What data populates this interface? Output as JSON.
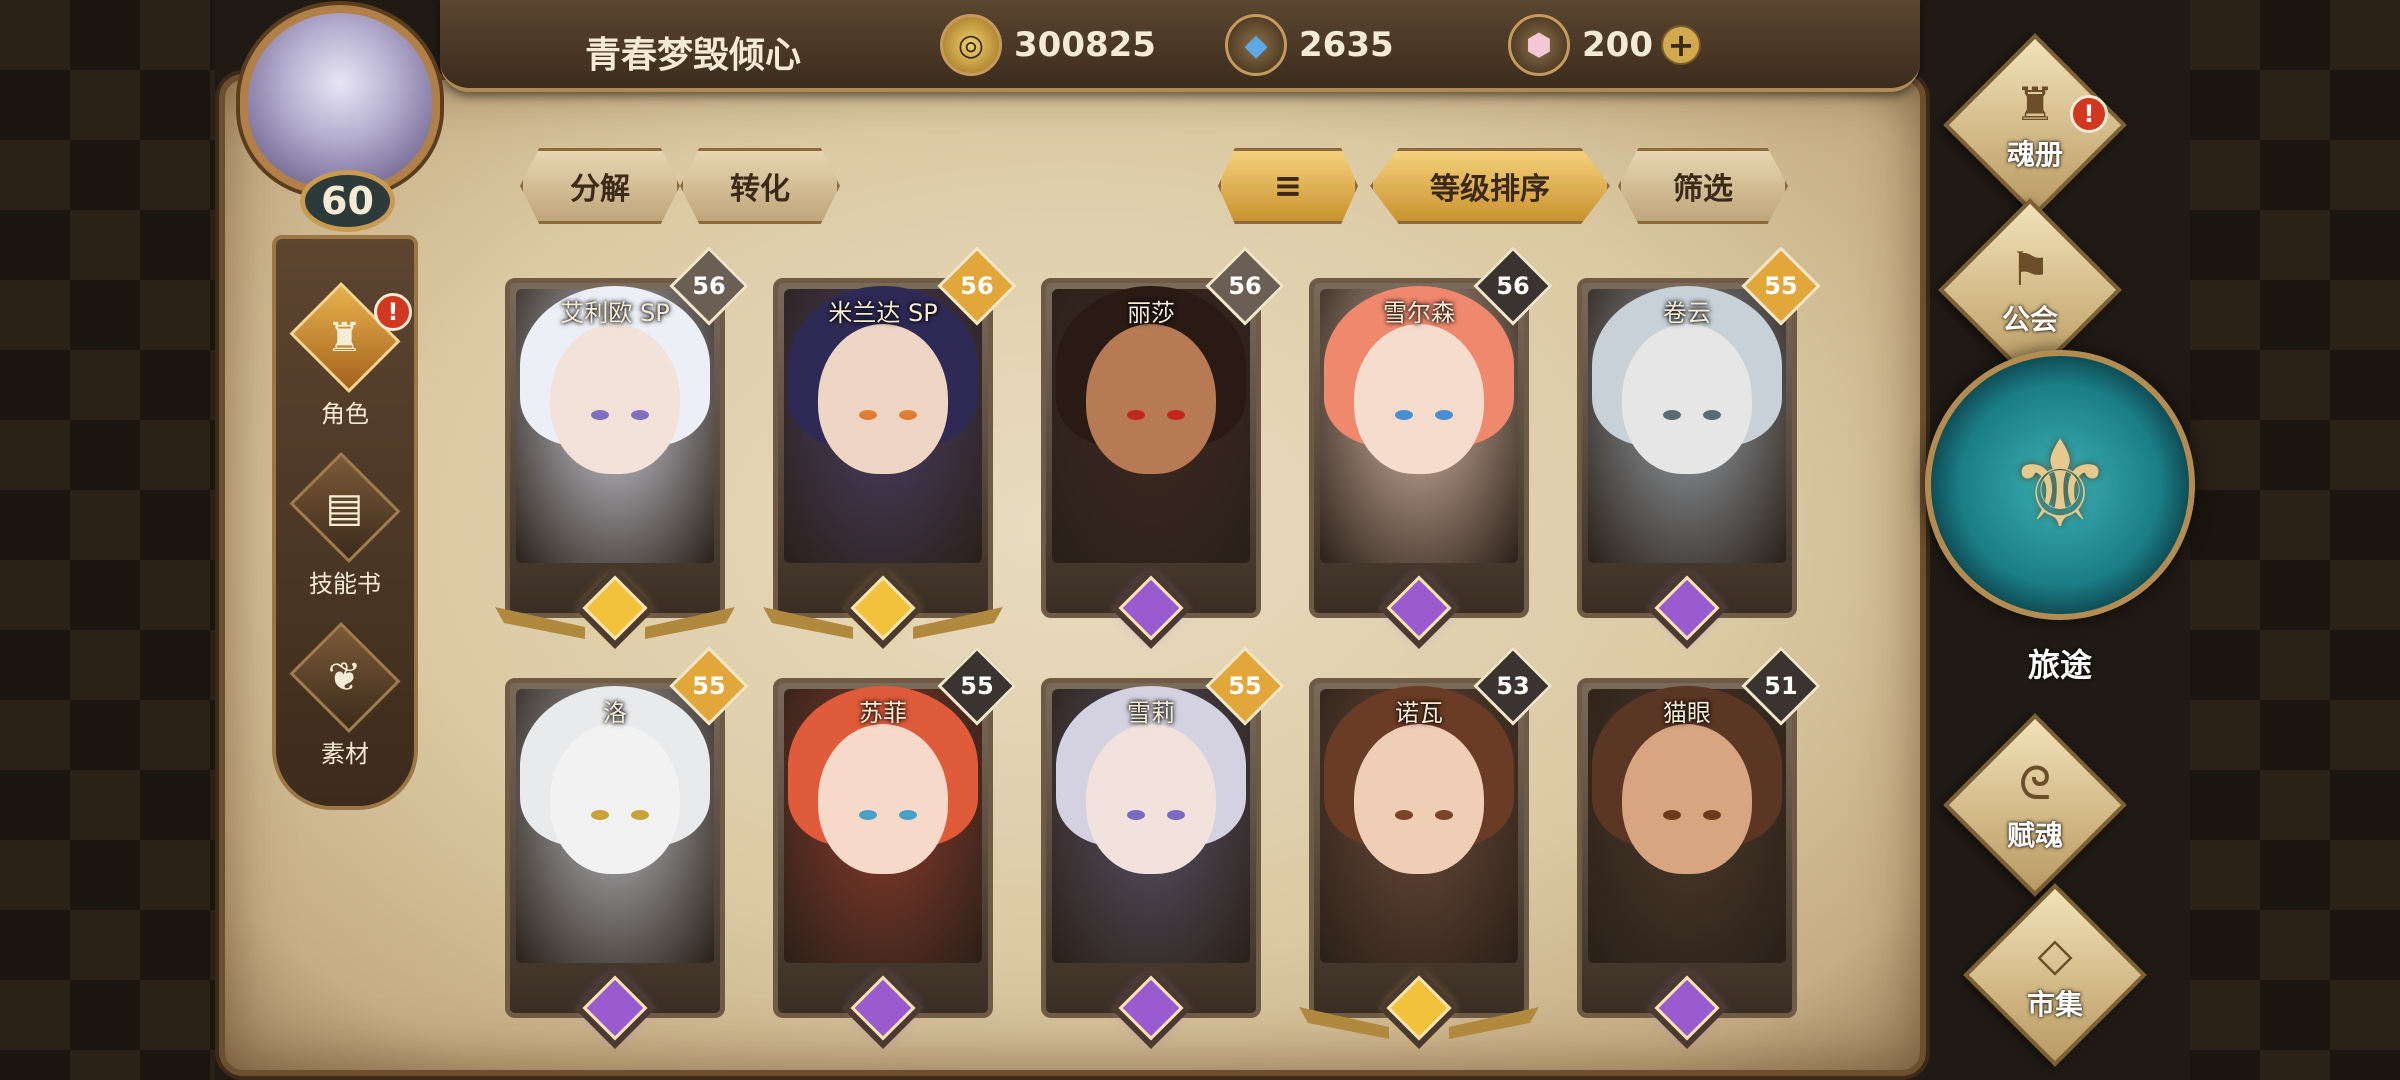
{
  "header": {
    "player_name": "青春梦毁倾心",
    "level": "60",
    "currencies": [
      {
        "name": "gold-coin",
        "value": "300825"
      },
      {
        "name": "blue-crystal",
        "value": "2635"
      },
      {
        "name": "pink-gem",
        "value": "200"
      }
    ]
  },
  "actions": {
    "decompose": "分解",
    "convert": "转化",
    "sort_by_level": "等级排序",
    "filter": "筛选"
  },
  "left_nav": [
    {
      "label": "角色",
      "icon": "helmet-icon",
      "active": true,
      "alert": "!"
    },
    {
      "label": "技能书",
      "icon": "book-icon",
      "active": false
    },
    {
      "label": "素材",
      "icon": "material-icon",
      "active": false
    }
  ],
  "right_nav": {
    "soul_book": "魂册",
    "soul_book_alert": "!",
    "guild": "公会",
    "journey": "旅途",
    "soul_grant": "赋魂",
    "market": "市集"
  },
  "cards": [
    {
      "name": "艾利欧 SP",
      "level": "56",
      "rarity": "gold"
    },
    {
      "name": "米兰达 SP",
      "level": "56",
      "rarity": "gold"
    },
    {
      "name": "丽莎",
      "level": "56",
      "rarity": "purple"
    },
    {
      "name": "雪尔森",
      "level": "56",
      "rarity": "purple"
    },
    {
      "name": "卷云",
      "level": "55",
      "rarity": "purple"
    },
    {
      "name": "洛",
      "level": "55",
      "rarity": "purple"
    },
    {
      "name": "苏菲",
      "level": "55",
      "rarity": "purple"
    },
    {
      "name": "雪莉",
      "level": "55",
      "rarity": "purple"
    },
    {
      "name": "诺瓦",
      "level": "53",
      "rarity": "gold"
    },
    {
      "name": "猫眼",
      "level": "51",
      "rarity": "purple"
    }
  ],
  "colors": {
    "gold_badge": "#e2a73a",
    "dark_badge": "#3a3330",
    "purple_gem": "#9b5bd0",
    "gold_gem": "#f2c23a"
  }
}
